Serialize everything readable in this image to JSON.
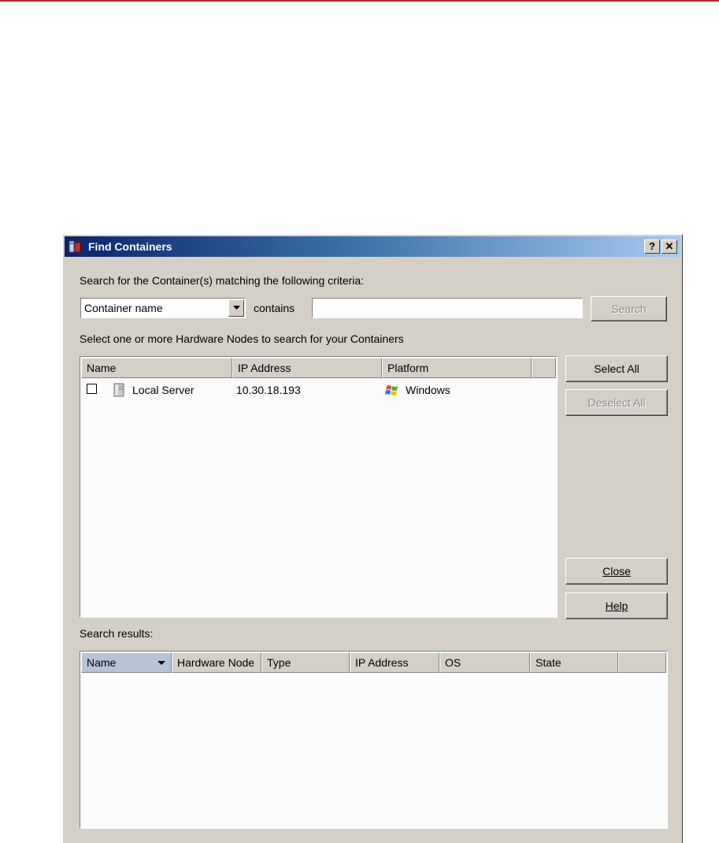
{
  "dialog": {
    "title": "Find Containers",
    "help_button": "?",
    "close_button": "✕"
  },
  "criteria": {
    "heading": "Search for the Container(s) matching the following criteria:",
    "field_select": "Container name",
    "operator_label": "contains",
    "search_value": "",
    "search_button": "Search"
  },
  "nodes": {
    "heading": "Select one or more Hardware Nodes to search for your Containers",
    "columns": [
      "Name",
      "IP Address",
      "Platform"
    ],
    "rows": [
      {
        "checked": false,
        "name": "Local Server",
        "ip": "10.30.18.193",
        "platform": "Windows"
      }
    ],
    "select_all": "Select All",
    "deselect_all": "Deselect All",
    "close": "Close",
    "help": "Help"
  },
  "results": {
    "heading": "Search results:",
    "columns": [
      "Name",
      "Hardware Node",
      "Type",
      "IP Address",
      "OS",
      "State"
    ]
  },
  "colors": {
    "title_gradient_start": "#0a246a",
    "title_gradient_end": "#a6caf0",
    "dialog_bg": "#d4d0c8",
    "accent_rule": "#b5282e"
  }
}
